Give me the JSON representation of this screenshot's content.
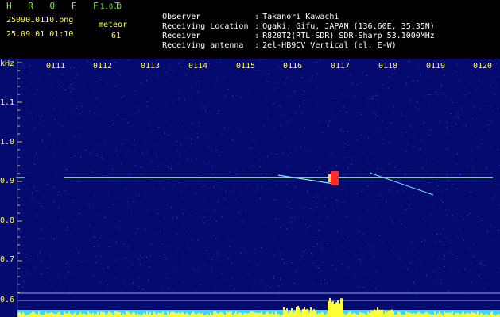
{
  "app": {
    "brand": "H R O F F T",
    "version": "1.0.0"
  },
  "file": {
    "name": "2509010110.png",
    "datetime": "25.09.01 01:10"
  },
  "meteor": {
    "label": "meteor",
    "count": "61"
  },
  "info": [
    {
      "key": "Observer",
      "value": "Takanori Kawachi"
    },
    {
      "key": "Receiving Location",
      "value": "Ogaki, Gifu, JAPAN (136.60E, 35.35N)"
    },
    {
      "key": "Receiver",
      "value": "R820T2(RTL-SDR) SDR-Sharp 53.1000MHz"
    },
    {
      "key": "Receiving antenna",
      "value": "2el-HB9CV Vertical (el. E-W)"
    }
  ],
  "separator": ":",
  "axis": {
    "y_unit": "kHz",
    "y_ticks": [
      "1.1",
      "1.0",
      "0.9",
      "0.8",
      "0.7",
      "0.6"
    ],
    "x_ticks": [
      "0111",
      "0112",
      "0113",
      "0114",
      "0115",
      "0116",
      "0117",
      "0118",
      "0119",
      "0120"
    ]
  },
  "colors": {
    "background": "#000000",
    "spectrogram_bg": "#050a6e",
    "header_green": "#7cf04a",
    "header_yellow": "#ffff3a",
    "axis_yellow": "#ffff3a",
    "signal_line": "#b8ffb0",
    "signal_hot": "#ff2a2a",
    "power_fill": "#ffff3a",
    "power_base": "#39d8ff"
  }
}
